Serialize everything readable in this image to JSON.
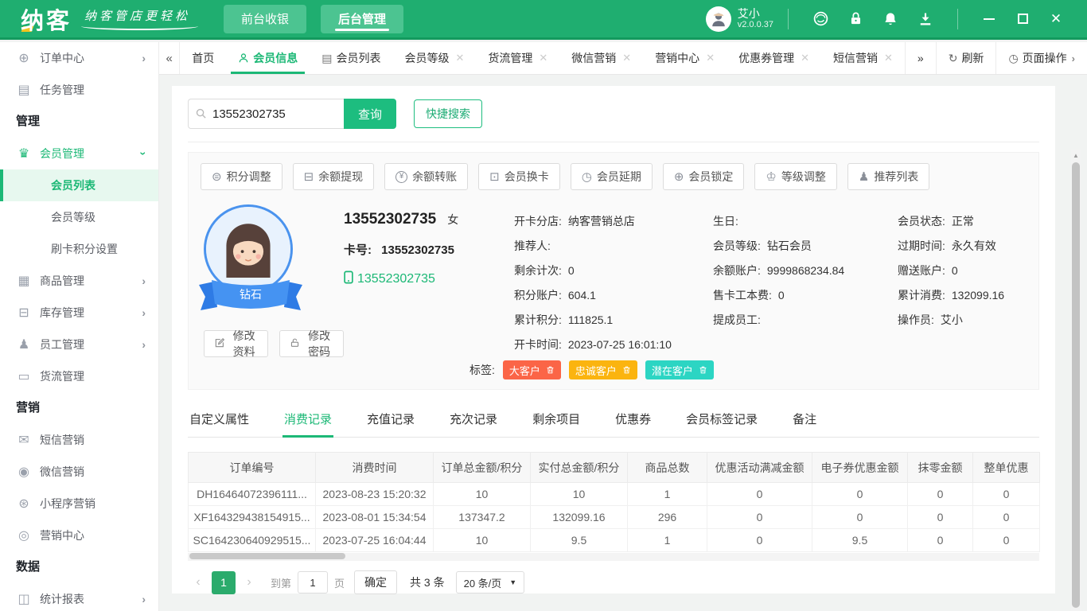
{
  "topbar": {
    "logo": "纳客",
    "slogan": "纳客管店更轻松",
    "nav": [
      {
        "label": "前台收银",
        "active": false
      },
      {
        "label": "后台管理",
        "active": true
      }
    ],
    "user": {
      "name": "艾小",
      "version": "v2.0.0.37"
    }
  },
  "sidebar": {
    "items": [
      {
        "type": "item",
        "label": "订单中心",
        "icon": "globe-icon",
        "expand": true
      },
      {
        "type": "item",
        "label": "任务管理",
        "icon": "task-icon"
      },
      {
        "type": "section",
        "label": "管理"
      },
      {
        "type": "item",
        "label": "会员管理",
        "icon": "crown-icon",
        "open": true,
        "active": true
      },
      {
        "type": "sub",
        "label": "会员列表",
        "selected": true
      },
      {
        "type": "sub",
        "label": "会员等级"
      },
      {
        "type": "sub",
        "label": "刷卡积分设置"
      },
      {
        "type": "item",
        "label": "商品管理",
        "icon": "goods-icon",
        "expand": true
      },
      {
        "type": "item",
        "label": "库存管理",
        "icon": "inventory-icon",
        "expand": true
      },
      {
        "type": "item",
        "label": "员工管理",
        "icon": "staff-icon",
        "expand": true
      },
      {
        "type": "item",
        "label": "货流管理",
        "icon": "truck-icon"
      },
      {
        "type": "section",
        "label": "营销"
      },
      {
        "type": "item",
        "label": "短信营销",
        "icon": "sms-icon"
      },
      {
        "type": "item",
        "label": "微信营销",
        "icon": "wechat-icon"
      },
      {
        "type": "item",
        "label": "小程序营销",
        "icon": "miniapp-icon"
      },
      {
        "type": "item",
        "label": "营销中心",
        "icon": "target-icon"
      },
      {
        "type": "section",
        "label": "数据"
      },
      {
        "type": "item",
        "label": "统计报表",
        "icon": "chart-icon",
        "expand": true
      }
    ]
  },
  "tabbar": {
    "collapse_left": "«",
    "tabs": [
      {
        "label": "首页"
      },
      {
        "label": "会员信息",
        "active": true,
        "icon": "user-icon"
      },
      {
        "label": "会员列表",
        "icon": "list-icon"
      },
      {
        "label": "会员等级",
        "closable": true
      },
      {
        "label": "货流管理",
        "closable": true
      },
      {
        "label": "微信营销",
        "closable": true
      },
      {
        "label": "营销中心",
        "closable": true
      },
      {
        "label": "优惠券管理",
        "closable": true
      },
      {
        "label": "短信营销",
        "closable": true
      }
    ],
    "collapse_right": "»",
    "refresh": "刷新",
    "page_ops": "页面操作"
  },
  "search": {
    "value": "13552302735",
    "query": "查询",
    "quick": "快捷搜索"
  },
  "member": {
    "actions": [
      {
        "label": "积分调整",
        "icon": "coins-icon"
      },
      {
        "label": "余额提现",
        "icon": "wallet-icon"
      },
      {
        "label": "余额转账",
        "icon": "transfer-yen-icon"
      },
      {
        "label": "会员换卡",
        "icon": "card-icon"
      },
      {
        "label": "会员延期",
        "icon": "clock-icon"
      },
      {
        "label": "会员锁定",
        "icon": "plus-circle-icon"
      },
      {
        "label": "等级调整",
        "icon": "crown-outline-icon"
      },
      {
        "label": "推荐列表",
        "icon": "person-icon"
      }
    ],
    "name": "13552302735",
    "gender": "女",
    "card_label": "卡号:",
    "card_no": "13552302735",
    "phone": "13552302735",
    "badge": "钻石",
    "edit_profile": "修改资料",
    "edit_password": "修改密码",
    "detail_columns": [
      [
        {
          "label": "开卡分店:",
          "value": "纳客营销总店"
        },
        {
          "label": "推荐人:",
          "value": ""
        },
        {
          "label": "剩余计次:",
          "value": "0"
        },
        {
          "label": "积分账户:",
          "value": "604.1"
        },
        {
          "label": "累计积分:",
          "value": "111825.1"
        },
        {
          "label": "开卡时间:",
          "value": "2023-07-25 16:01:10"
        }
      ],
      [
        {
          "label": "生日:",
          "value": ""
        },
        {
          "label": "会员等级:",
          "value": "钻石会员"
        },
        {
          "label": "余额账户:",
          "value": "9999868234.84"
        },
        {
          "label": "售卡工本费:",
          "value": "0"
        },
        {
          "label": "提成员工:",
          "value": ""
        }
      ],
      [
        {
          "label": "会员状态:",
          "value": "正常"
        },
        {
          "label": "过期时间:",
          "value": "永久有效"
        },
        {
          "label": "赠送账户:",
          "value": "0"
        },
        {
          "label": "累计消费:",
          "value": "132099.16"
        },
        {
          "label": "操作员:",
          "value": "艾小"
        }
      ]
    ],
    "tags_label": "标签:",
    "tags": [
      {
        "text": "大客户",
        "color": "#fb6547"
      },
      {
        "text": "忠诚客户",
        "color": "#fbb40f"
      },
      {
        "text": "潜在客户",
        "color": "#2cd5c3"
      }
    ]
  },
  "detail_tabs": [
    {
      "label": "自定义属性"
    },
    {
      "label": "消费记录",
      "active": true
    },
    {
      "label": "充值记录"
    },
    {
      "label": "充次记录"
    },
    {
      "label": "剩余项目"
    },
    {
      "label": "优惠券"
    },
    {
      "label": "会员标签记录"
    },
    {
      "label": "备注"
    }
  ],
  "table": {
    "headers": [
      "订单编号",
      "消费时间",
      "订单总金额/积分",
      "实付总金额/积分",
      "商品总数",
      "优惠活动满减金额",
      "电子券优惠金额",
      "抹零金额",
      "整单优惠"
    ],
    "rows": [
      [
        "DH16464072396111...",
        "2023-08-23 15:20:32",
        "10",
        "10",
        "1",
        "0",
        "0",
        "0",
        "0"
      ],
      [
        "XF164329438154915...",
        "2023-08-01 15:34:54",
        "137347.2",
        "132099.16",
        "296",
        "0",
        "0",
        "0",
        "0"
      ],
      [
        "SC164230640929515...",
        "2023-07-25 16:04:44",
        "10",
        "9.5",
        "1",
        "0",
        "9.5",
        "0",
        "0"
      ]
    ]
  },
  "pagination": {
    "prev": "‹",
    "page": "1",
    "next": "›",
    "goto_label": "到第",
    "goto_value": "1",
    "page_unit": "页",
    "confirm": "确定",
    "total": "共 3 条",
    "page_size": "20 条/页"
  },
  "colors": {
    "accent": "#1cb876",
    "topbar": "#1fae70",
    "query_button": "#1dbd7f"
  }
}
